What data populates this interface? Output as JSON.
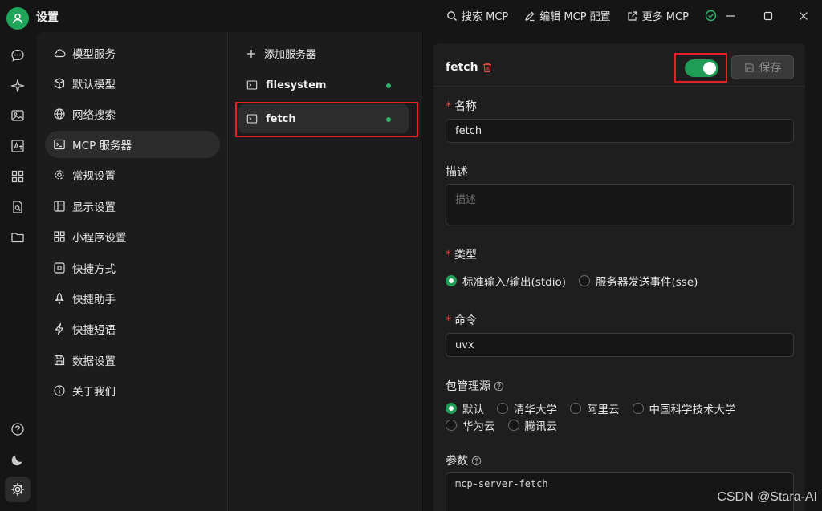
{
  "app": {
    "title": "设置"
  },
  "titlebar": {
    "search_mcp": "搜索 MCP",
    "edit_mcp": "编辑 MCP 配置",
    "more_mcp": "更多 MCP"
  },
  "nav": {
    "items": [
      {
        "label": "模型服务",
        "icon": "cloud-icon"
      },
      {
        "label": "默认模型",
        "icon": "cube-icon"
      },
      {
        "label": "网络搜索",
        "icon": "globe-icon"
      },
      {
        "label": "MCP 服务器",
        "icon": "terminal-icon",
        "active": true
      },
      {
        "label": "常规设置",
        "icon": "gear-icon"
      },
      {
        "label": "显示设置",
        "icon": "layout-icon"
      },
      {
        "label": "小程序设置",
        "icon": "grid-icon"
      },
      {
        "label": "快捷方式",
        "icon": "command-icon"
      },
      {
        "label": "快捷助手",
        "icon": "rocket-icon"
      },
      {
        "label": "快捷短语",
        "icon": "zap-icon"
      },
      {
        "label": "数据设置",
        "icon": "save-icon"
      },
      {
        "label": "关于我们",
        "icon": "info-icon"
      }
    ]
  },
  "servers": {
    "add_label": "添加服务器",
    "items": [
      {
        "name": "filesystem",
        "status_color": "#2fb36a"
      },
      {
        "name": "fetch",
        "status_color": "#2fb36a",
        "active": true
      }
    ]
  },
  "detail": {
    "server_name": "fetch",
    "toggle_on": true,
    "save_label": "保存",
    "name_label": "名称",
    "name_value": "fetch",
    "desc_label": "描述",
    "desc_placeholder": "描述",
    "type_label": "类型",
    "type_options": [
      "标准输入/输出(stdio)",
      "服务器发送事件(sse)"
    ],
    "type_selected": 0,
    "command_label": "命令",
    "command_value": "uvx",
    "registry_label": "包管理源",
    "registry_options": [
      "默认",
      "清华大学",
      "阿里云",
      "中国科学技术大学",
      "华为云",
      "腾讯云"
    ],
    "registry_selected": 0,
    "args_label": "参数",
    "args_value": "mcp-server-fetch"
  },
  "colors": {
    "accent": "#1f9c55",
    "highlight_box": "#e8202a",
    "required": "#e0493f"
  },
  "watermark": "CSDN @Stara-AI"
}
